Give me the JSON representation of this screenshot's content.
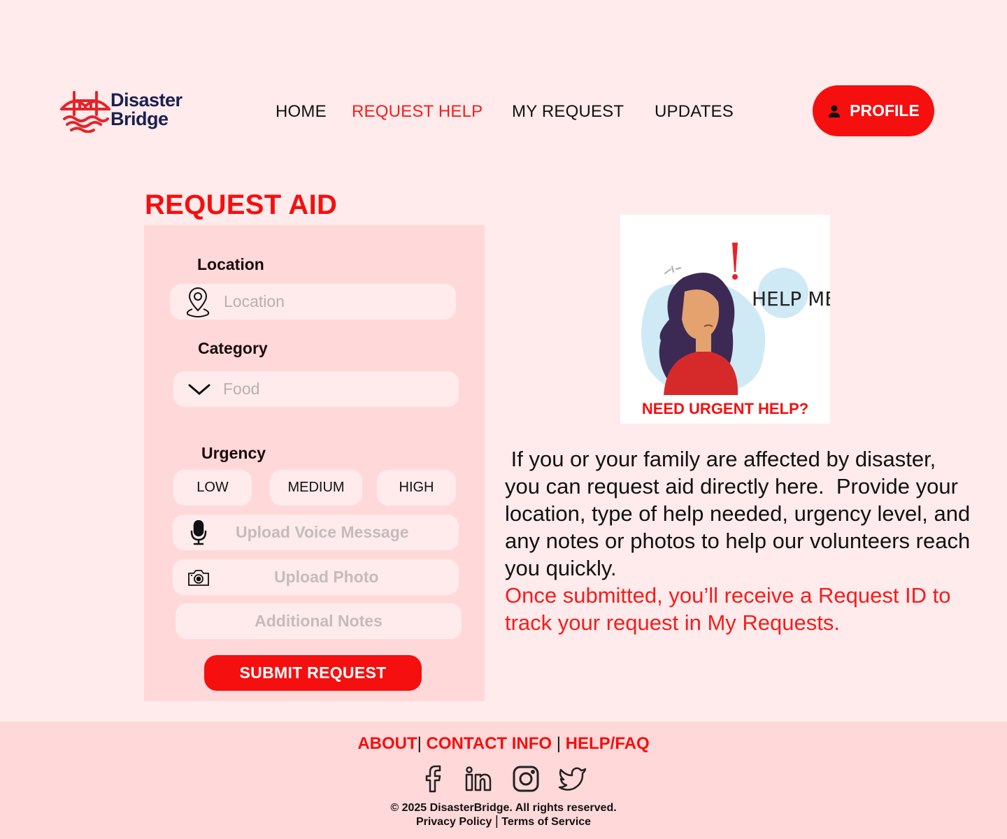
{
  "brand": {
    "line1": "Disaster",
    "line2": "Bridge"
  },
  "nav": {
    "home": "HOME",
    "request_help": "REQUEST HELP",
    "my_request": "MY REQUEST",
    "updates": "UPDATES",
    "profile": "PROFILE"
  },
  "form": {
    "title": "REQUEST AID",
    "location_label": "Location",
    "location_placeholder": "Location",
    "category_label": "Category",
    "category_value": "Food",
    "urgency_label": "Urgency",
    "urgency_options": [
      "LOW",
      "MEDIUM",
      "HIGH"
    ],
    "voice_label": "Upload Voice Message",
    "photo_label": "Upload Photo",
    "notes_placeholder": "Additional Notes",
    "submit_label": "SUBMIT REQUEST"
  },
  "illustration": {
    "speech_text": "HELP ME",
    "caption": "NEED URGENT HELP?"
  },
  "info": {
    "paragraph": " If you or your family are affected by disaster, you can request aid directly here.  Provide your location, type of help needed, urgency level, and any notes or photos to help our volunteers reach you quickly.",
    "highlight": "Once submitted, you’ll receive a Request ID to track your request in My Requests."
  },
  "footer": {
    "about": "ABOUT",
    "contact": "CONTACT INFO",
    "help": "HELP/FAQ",
    "copyright": "© 2025 DisasterBridge. All rights reserved.",
    "privacy": "Privacy Policy",
    "terms": "Terms of Service",
    "social_icons": [
      "facebook-icon",
      "linkedin-icon",
      "instagram-icon",
      "twitter-icon"
    ]
  },
  "colors": {
    "accent": "#f50f0f",
    "page_bg": "#ffebeb",
    "panel_bg": "#ffd9d9",
    "brand_navy": "#1a2050"
  }
}
